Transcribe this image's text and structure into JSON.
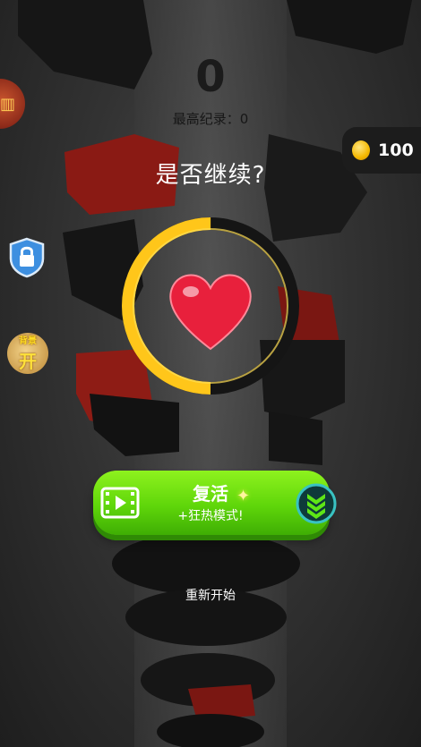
{
  "score": "0",
  "best_score_label": "最高纪录：0",
  "continue_prompt": "是否继续?",
  "coins": "100",
  "revive_button": {
    "label": "复活",
    "sublabel": "+狂热模式!"
  },
  "restart_label": "重新开始",
  "side_buttons": {
    "chest_icon": "chest-icon",
    "lock_icon": "lock-icon",
    "skin_icon": "skin-shop-icon"
  },
  "skin_badge": {
    "top_text": "背景",
    "big_text": "开"
  },
  "revive_timer_progress": 0.5,
  "colors": {
    "timer_ring": "#ffc61a",
    "revive_button": "#6cdc0e",
    "heart": "#e8203c",
    "coin": "#f5b800",
    "danger_platform": "#8a1a14"
  }
}
